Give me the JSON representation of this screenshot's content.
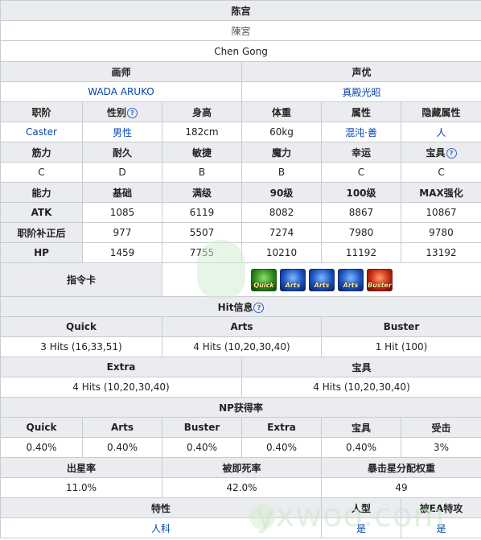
{
  "name_cn": "陈宫",
  "name_jp": "陳宮",
  "name_en": "Chen Gong",
  "headers": {
    "illustrator": "画师",
    "voice": "声优"
  },
  "illustrator": "WADA ARUKO",
  "voice_actor": "真殿光昭",
  "basic_headers": [
    "职阶",
    "性别",
    "身高",
    "体重",
    "属性",
    "隐藏属性"
  ],
  "basic_values": [
    "Caster",
    "男性",
    "182cm",
    "60kg",
    "混沌·善",
    "人"
  ],
  "param_headers": [
    "筋力",
    "耐久",
    "敏捷",
    "魔力",
    "幸运",
    "宝具"
  ],
  "param_values": [
    "C",
    "D",
    "B",
    "B",
    "C",
    "C"
  ],
  "stat_headers": [
    "能力",
    "基础",
    "满级",
    "90级",
    "100级",
    "MAX强化"
  ],
  "stat_rows": [
    {
      "label": "ATK",
      "values": [
        "1085",
        "6119",
        "8082",
        "8867",
        "10867"
      ]
    },
    {
      "label": "职阶补正后",
      "values": [
        "977",
        "5507",
        "7274",
        "7980",
        "9780"
      ]
    },
    {
      "label": "HP",
      "values": [
        "1459",
        "7755",
        "10210",
        "11192",
        "13192"
      ]
    }
  ],
  "cmd_label": "指令卡",
  "cards": [
    "Quick",
    "Arts",
    "Arts",
    "Arts",
    "Buster"
  ],
  "hit_title": "Hit信息",
  "hit_headers": [
    "Quick",
    "Arts",
    "Buster"
  ],
  "hit_values": [
    "3 Hits (16,33,51)",
    "4 Hits (10,20,30,40)",
    "1 Hit (100)"
  ],
  "hit2_headers": [
    "Extra",
    "宝具"
  ],
  "hit2_values": [
    "4 Hits (10,20,30,40)",
    "4 Hits (10,20,30,40)"
  ],
  "np_title": "NP获得率",
  "np_headers": [
    "Quick",
    "Arts",
    "Buster",
    "Extra",
    "宝具",
    "受击"
  ],
  "np_values": [
    "0.40%",
    "0.40%",
    "0.40%",
    "0.40%",
    "0.40%",
    "3%"
  ],
  "star_headers": [
    "出星率",
    "被即死率",
    "暴击星分配权重"
  ],
  "star_values": [
    "11.0%",
    "42.0%",
    "49"
  ],
  "trait_headers": [
    "特性",
    "人型",
    "被EA特攻"
  ],
  "trait_values": [
    "人科",
    "是",
    "是"
  ],
  "watermark": "yxwoo.com",
  "help_mark": "?"
}
